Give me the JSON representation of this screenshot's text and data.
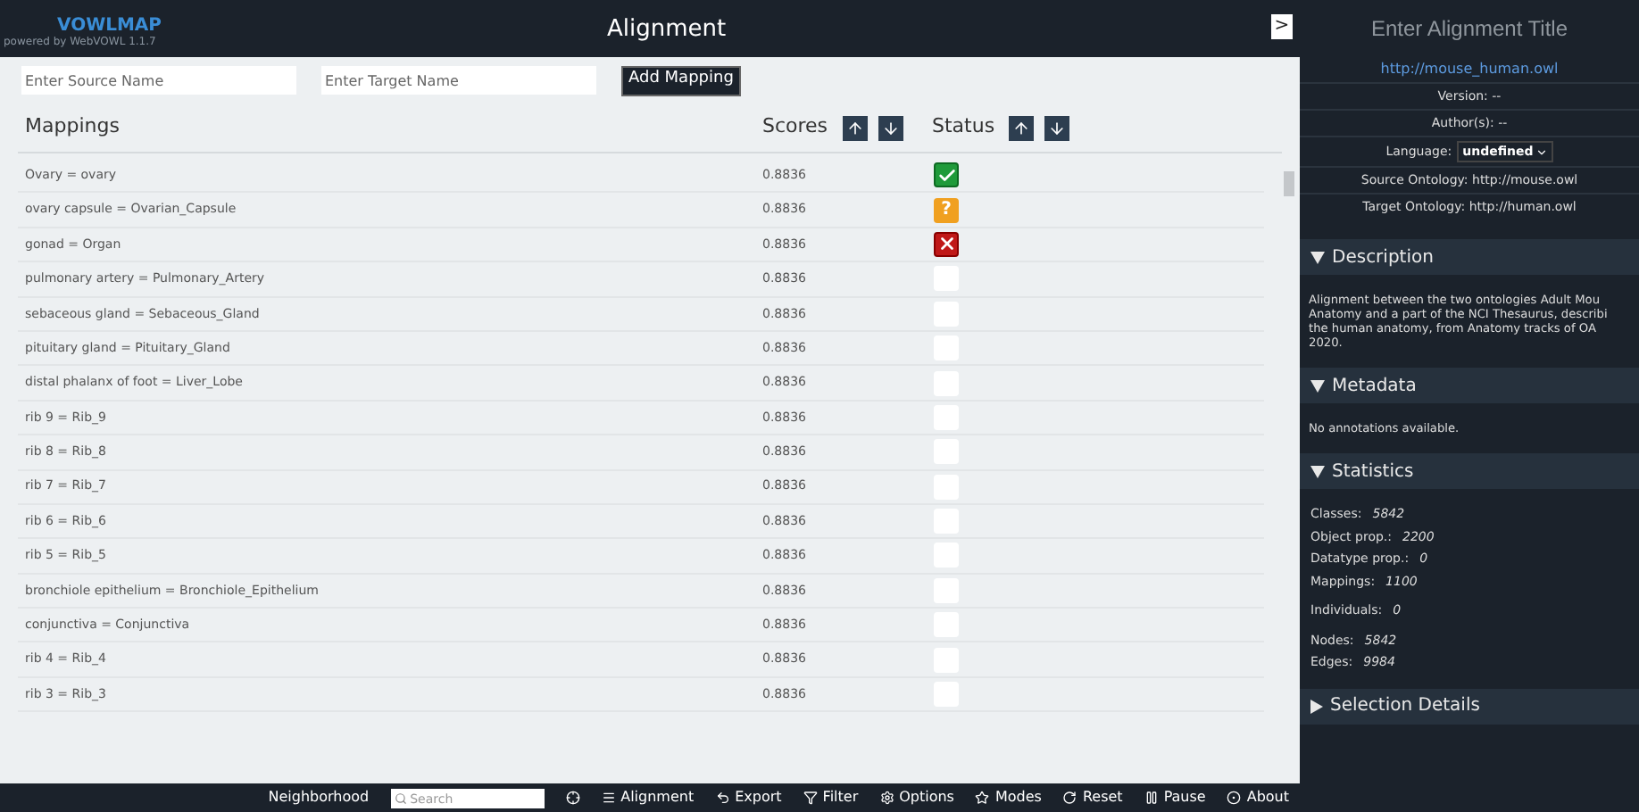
{
  "header": {
    "logo": "VOWLMAP",
    "subtitle": "powered by WebVOWL 1.1.7",
    "title": "Alignment",
    "toggle": ">"
  },
  "form": {
    "source": {
      "placeholder": "Enter Source Name"
    },
    "target": {
      "placeholder": "Enter Target Name"
    },
    "button": "Add Mapping"
  },
  "table": {
    "columns": [
      "Mappings",
      "Scores",
      "Status"
    ],
    "rows": [
      {
        "mapping": "Ovary = ovary",
        "score": "0.8836",
        "kind": "accepted"
      },
      {
        "mapping": "ovary capsule = Ovarian_Capsule",
        "score": "0.8836",
        "kind": "unsure",
        "symbol": "?"
      },
      {
        "mapping": "gonad = Organ",
        "score": "0.8836",
        "kind": "rejected"
      },
      {
        "mapping": "pulmonary artery = Pulmonary_Artery",
        "score": "0.8836",
        "kind": "empty"
      },
      {
        "mapping": "sebaceous gland = Sebaceous_Gland",
        "score": "0.8836",
        "kind": "empty"
      },
      {
        "mapping": "pituitary gland = Pituitary_Gland",
        "score": "0.8836",
        "kind": "empty"
      },
      {
        "mapping": "distal phalanx of foot = Liver_Lobe",
        "score": "0.8836",
        "kind": "empty"
      },
      {
        "mapping": "rib 9 = Rib_9",
        "score": "0.8836",
        "kind": "empty"
      },
      {
        "mapping": "rib 8 = Rib_8",
        "score": "0.8836",
        "kind": "empty"
      },
      {
        "mapping": "rib 7 = Rib_7",
        "score": "0.8836",
        "kind": "empty"
      },
      {
        "mapping": "rib 6 = Rib_6",
        "score": "0.8836",
        "kind": "empty"
      },
      {
        "mapping": "rib 5 = Rib_5",
        "score": "0.8836",
        "kind": "empty"
      },
      {
        "mapping": "bronchiole epithelium = Bronchiole_Epithelium",
        "score": "0.8836",
        "kind": "empty"
      },
      {
        "mapping": "conjunctiva = Conjunctiva",
        "score": "0.8836",
        "kind": "empty"
      },
      {
        "mapping": "rib 4 = Rib_4",
        "score": "0.8836",
        "kind": "empty"
      },
      {
        "mapping": "rib 3 = Rib_3",
        "score": "0.8836",
        "kind": "empty"
      }
    ]
  },
  "toolbar": {
    "neighborhood": "Neighborhood",
    "search": {
      "placeholder": "Search"
    },
    "items": [
      "Alignment",
      "Export",
      "Filter",
      "Options",
      "Modes",
      "Reset",
      "Pause",
      "About"
    ]
  },
  "sidebar": {
    "title": "Enter Alignment Title",
    "url": "http://mouse_human.owl",
    "version": "Version: --",
    "authors": "Author(s): --",
    "language_label": "Language:",
    "language": "undefined",
    "source": "Source Ontology: http://mouse.owl",
    "target": "Target Ontology: http://human.owl",
    "sections": [
      {
        "title": "Description",
        "expanded": true,
        "kind": "text",
        "lines": [
          "Alignment between the two ontologies Adult Mou",
          "Anatomy and a part of the NCI Thesaurus, describi",
          "the human anatomy, from Anatomy tracks of OA",
          "2020."
        ]
      },
      {
        "title": "Metadata",
        "expanded": true,
        "kind": "text",
        "lines": [
          "No annotations available."
        ]
      },
      {
        "title": "Statistics",
        "expanded": true,
        "kind": "stats",
        "groups": [
          [
            {
              "label": "Classes:",
              "value": "5842"
            },
            {
              "label": "Object prop.:",
              "value": "2200"
            },
            {
              "label": "Datatype prop.:",
              "value": "0"
            },
            {
              "label": "Mappings:",
              "value": "1100"
            }
          ],
          [
            {
              "label": "Individuals:",
              "value": "0"
            }
          ],
          [
            {
              "label": "Nodes:",
              "value": "5842"
            },
            {
              "label": "Edges:",
              "value": "9984"
            }
          ]
        ]
      },
      {
        "title": "Selection Details",
        "expanded": false
      }
    ]
  }
}
